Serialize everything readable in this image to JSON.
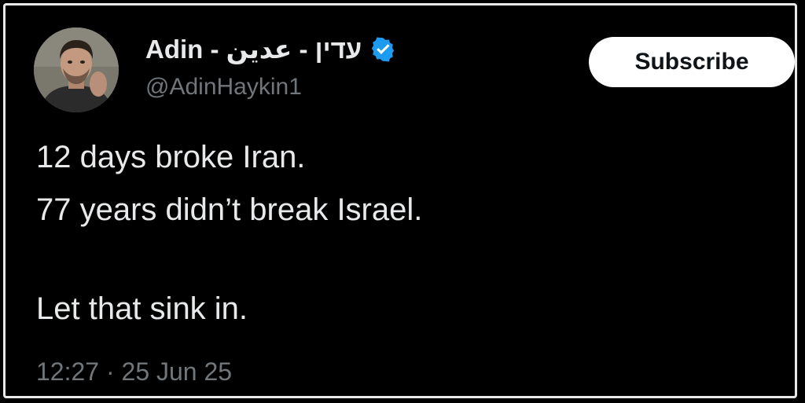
{
  "author": {
    "display_name": "Adin - עדין - عدين",
    "handle": "@AdinHaykin1",
    "verified": true,
    "verified_badge_icon": "verified-badge-icon",
    "verified_color": "#1d9bf0"
  },
  "actions": {
    "subscribe_label": "Subscribe"
  },
  "tweet": {
    "lines": [
      "12 days broke Iran.",
      "77 years didn’t break Israel.",
      "",
      "Let that sink in."
    ],
    "timestamp": "12:27 · 25 Jun 25"
  }
}
